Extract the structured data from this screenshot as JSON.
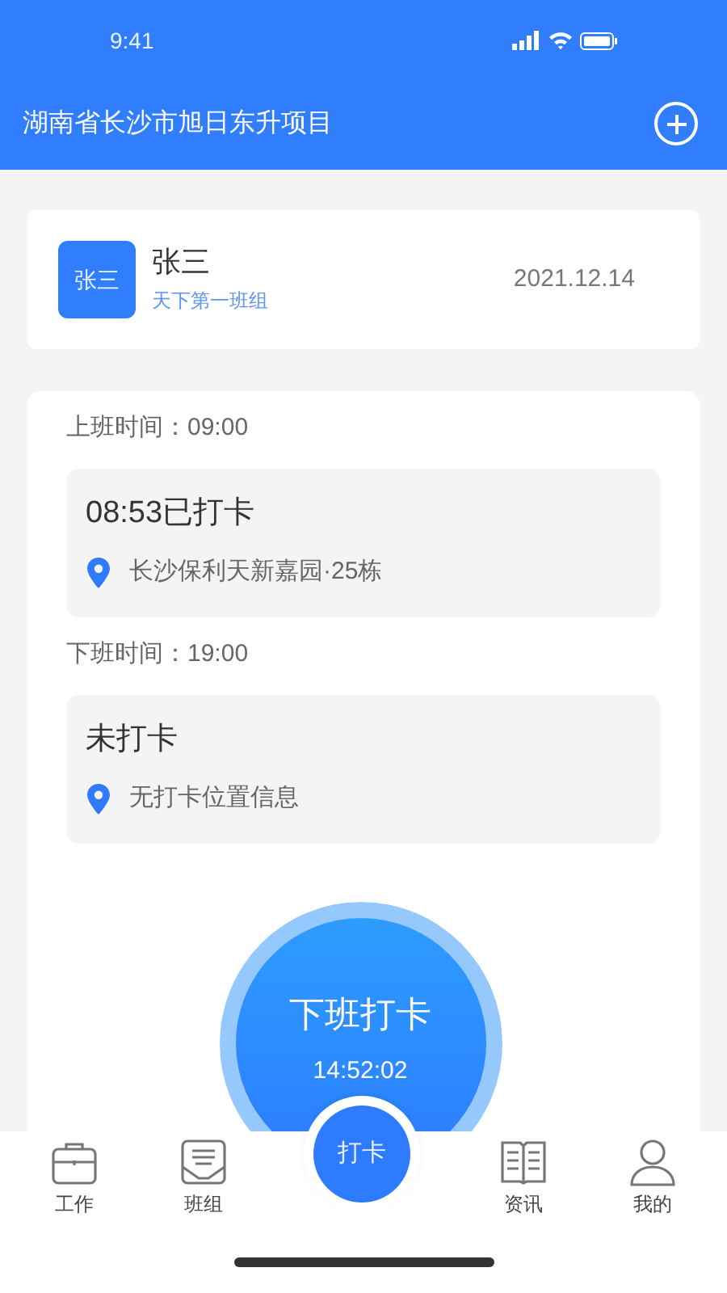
{
  "status_bar": {
    "time": "9:41"
  },
  "header": {
    "title": "湖南省长沙市旭日东升项目"
  },
  "profile": {
    "avatar_text": "张三",
    "name": "张三",
    "team": "天下第一班组",
    "date": "2021.12.14"
  },
  "shifts": [
    {
      "label": "上班时间：09:00",
      "status": "08:53已打卡",
      "location": "长沙保利天新嘉园·25栋"
    },
    {
      "label": "下班时间：19:00",
      "status": "未打卡",
      "location": "无打卡位置信息"
    }
  ],
  "punch_button": {
    "label": "下班打卡",
    "time": "14:52:02"
  },
  "tab_bar": [
    {
      "label": "工作",
      "kind": "briefcase"
    },
    {
      "label": "班组",
      "kind": "tray"
    },
    {
      "label": "打卡",
      "kind": "center"
    },
    {
      "label": "资讯",
      "kind": "book"
    },
    {
      "label": "我的",
      "kind": "person"
    }
  ]
}
